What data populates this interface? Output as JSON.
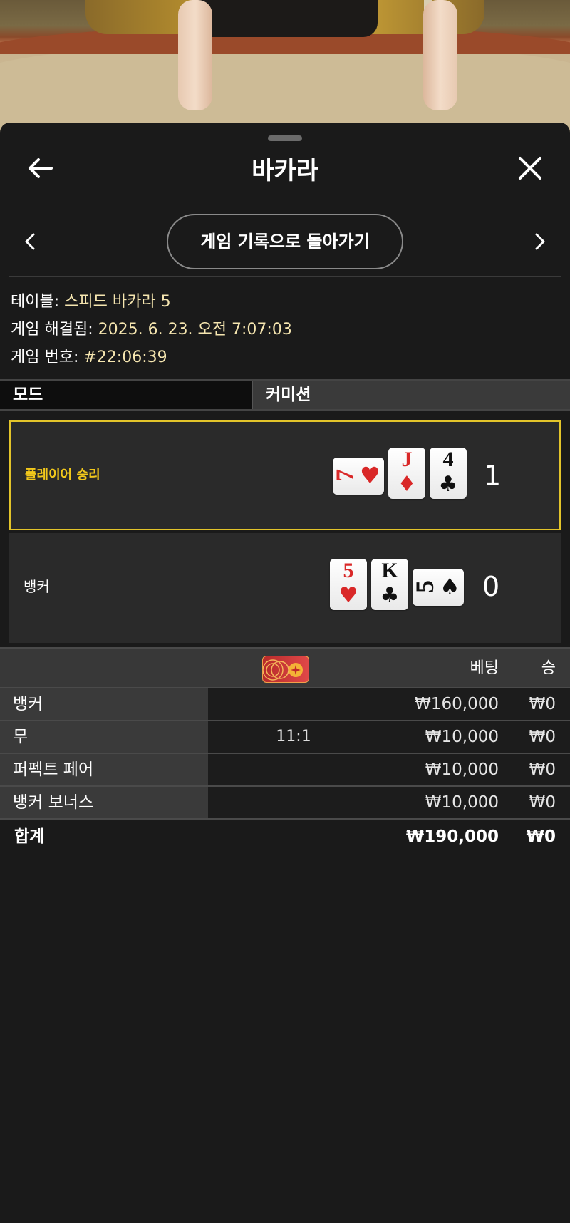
{
  "header": {
    "title": "바카라"
  },
  "nav": {
    "back_to_history": "게임 기록으로 돌아가기"
  },
  "info": {
    "table_label": "테이블: ",
    "table_value": "스피드 바카라 5",
    "resolved_label": "게임 해결됨: ",
    "resolved_value": "2025. 6. 23. 오전 7:07:03",
    "number_label": "게임 번호: ",
    "number_value": "#22:06:39"
  },
  "mode": {
    "left": "모드",
    "right": "커미션"
  },
  "result": {
    "player": {
      "label": "플레이어 승리",
      "score": "1",
      "cards": [
        {
          "rank": "7",
          "suit": "hearts",
          "suit_glyph": "♥",
          "color": "#d92828",
          "orientation": "sideways"
        },
        {
          "rank": "J",
          "suit": "diamonds",
          "suit_glyph": "♦",
          "color": "#d92828",
          "orientation": "upright"
        },
        {
          "rank": "4",
          "suit": "clubs",
          "suit_glyph": "♣",
          "color": "#111111",
          "orientation": "upright"
        }
      ]
    },
    "banker": {
      "label": "뱅커",
      "score": "0",
      "cards": [
        {
          "rank": "5",
          "suit": "hearts",
          "suit_glyph": "♥",
          "color": "#d92828",
          "orientation": "upright"
        },
        {
          "rank": "K",
          "suit": "clubs",
          "suit_glyph": "♣",
          "color": "#111111",
          "orientation": "upright"
        },
        {
          "rank": "5",
          "suit": "spades",
          "suit_glyph": "♠",
          "color": "#111111",
          "orientation": "sideways"
        }
      ]
    }
  },
  "bets": {
    "header": {
      "bet": "베팅",
      "win": "승"
    },
    "rows": [
      {
        "name": "뱅커",
        "odds": "",
        "bet": "₩160,000",
        "win": "₩0"
      },
      {
        "name": "무",
        "odds": "11:1",
        "bet": "₩10,000",
        "win": "₩0"
      },
      {
        "name": "퍼펙트 페어",
        "odds": "",
        "bet": "₩10,000",
        "win": "₩0"
      },
      {
        "name": "뱅커 보너스",
        "odds": "",
        "bet": "₩10,000",
        "win": "₩0"
      }
    ],
    "total": {
      "name": "합계",
      "bet": "₩190,000",
      "win": "₩0"
    }
  },
  "colors": {
    "accent_gold": "#e3c42a",
    "win_label": "#f2c81b",
    "info_value": "#f6e6b0",
    "red_suit": "#d92828"
  }
}
